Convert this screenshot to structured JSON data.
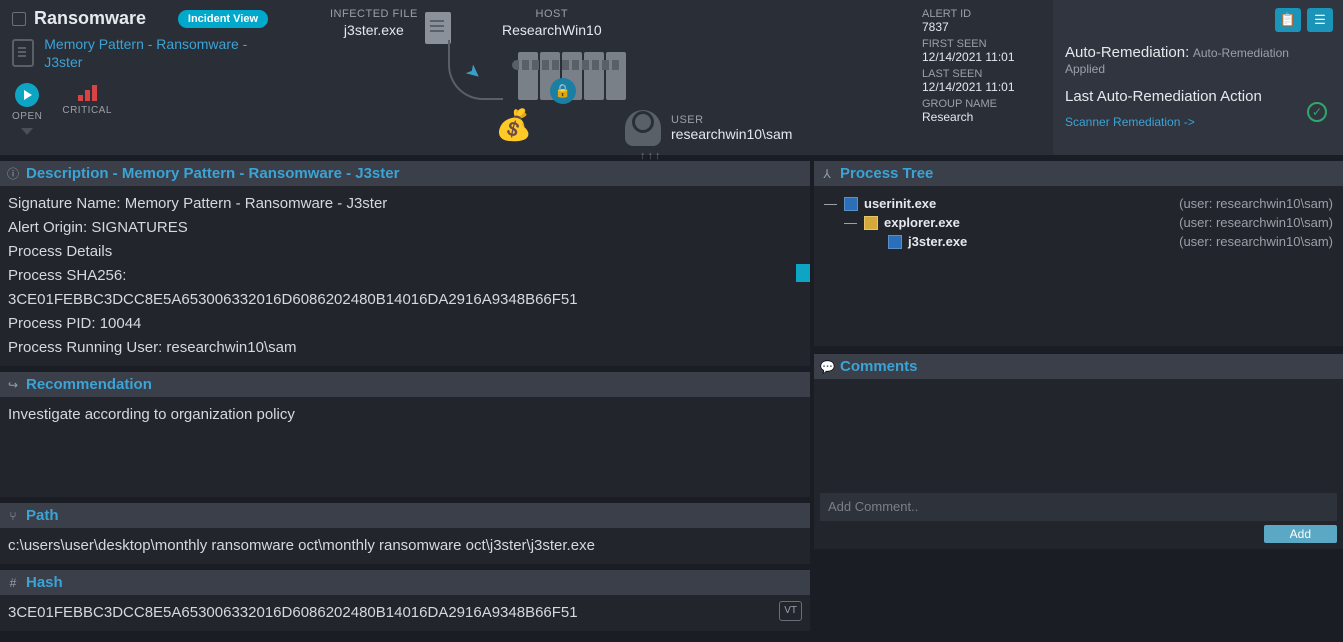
{
  "header": {
    "title": "Ransomware",
    "incidentBadge": "Incident View",
    "subtitle": "Memory Pattern - Ransomware - J3ster",
    "openLabel": "OPEN",
    "criticalLabel": "CRITICAL"
  },
  "infected": {
    "label": "INFECTED FILE",
    "filename": "j3ster.exe"
  },
  "host": {
    "label": "HOST",
    "name": "ResearchWin10"
  },
  "user": {
    "label": "USER",
    "name": "researchwin10\\sam"
  },
  "meta": {
    "alertIdLabel": "ALERT ID",
    "alertId": "7837",
    "firstSeenLabel": "FIRST SEEN",
    "firstSeen": "12/14/2021 11:01",
    "lastSeenLabel": "LAST SEEN",
    "lastSeen": "12/14/2021 11:01",
    "groupNameLabel": "GROUP NAME",
    "groupName": "Research"
  },
  "autoRemediation": {
    "label": "Auto-Remediation:",
    "value": "Auto-Remediation Applied",
    "lastActionLabel": "Last Auto-Remediation Action",
    "scannerLink": "Scanner Remediation ->"
  },
  "description": {
    "title": "Description - Memory Pattern - Ransomware - J3ster",
    "sigName": "Signature Name: Memory Pattern - Ransomware - J3ster",
    "origin": "Alert Origin: SIGNATURES",
    "procDetails": "Process Details",
    "sha256Label": "Process SHA256:",
    "sha256": "3CE01FEBBC3DCC8E5A653006332016D6086202480B14016DA2916A9348B66F51",
    "pid": "Process PID: 10044",
    "runningUser": "Process Running User: researchwin10\\sam"
  },
  "recommendation": {
    "title": "Recommendation",
    "text": "Investigate according to organization policy"
  },
  "path": {
    "title": "Path",
    "value": "c:\\users\\user\\desktop\\monthly ransomware oct\\monthly ransomware oct\\j3ster\\j3ster.exe"
  },
  "hash": {
    "title": "Hash",
    "value": "3CE01FEBBC3DCC8E5A653006332016D6086202480B14016DA2916A9348B66F51",
    "vtBadge": "VT"
  },
  "processTree": {
    "title": "Process Tree",
    "nodes": [
      {
        "name": "userinit.exe",
        "user": "(user: researchwin10\\sam)",
        "indent": 0,
        "icon": "app"
      },
      {
        "name": "explorer.exe",
        "user": "(user: researchwin10\\sam)",
        "indent": 1,
        "icon": "folder"
      },
      {
        "name": "j3ster.exe",
        "user": "(user: researchwin10\\sam)",
        "indent": 2,
        "icon": "app"
      }
    ]
  },
  "comments": {
    "title": "Comments",
    "placeholder": "Add Comment..",
    "addLabel": "Add"
  }
}
